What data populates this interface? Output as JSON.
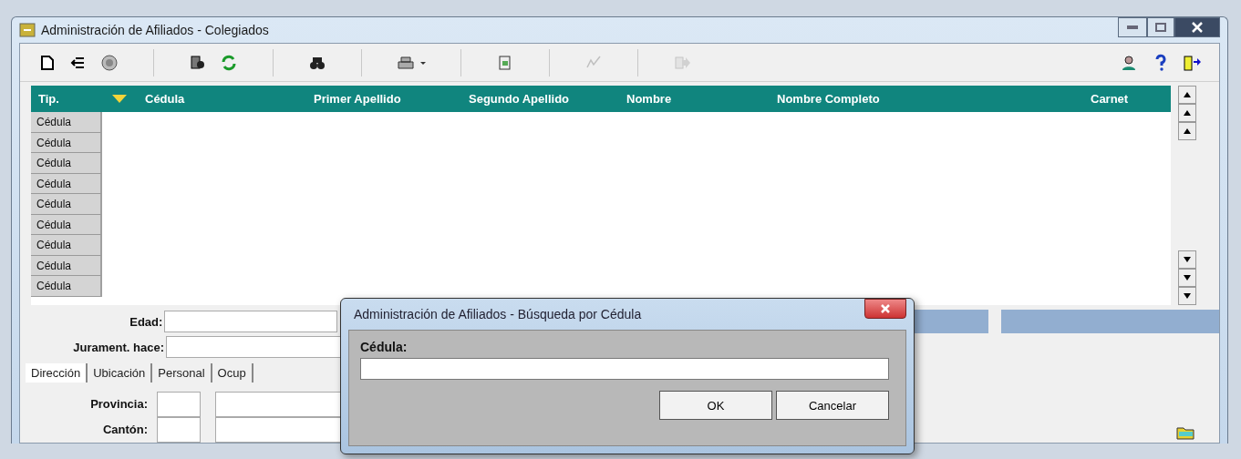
{
  "window": {
    "title": "Administración de Afiliados - Colegiados"
  },
  "toolbar": [
    {
      "kind": "new",
      "disabled": false
    },
    {
      "kind": "back",
      "disabled": false
    },
    {
      "kind": "seal",
      "disabled": false
    },
    {
      "kind": "sep"
    },
    {
      "kind": "find-doc",
      "disabled": false
    },
    {
      "kind": "refresh",
      "disabled": false
    },
    {
      "kind": "sep"
    },
    {
      "kind": "binoculars",
      "disabled": false
    },
    {
      "kind": "sep"
    },
    {
      "kind": "print",
      "disabled": false
    },
    {
      "kind": "sep"
    },
    {
      "kind": "export",
      "disabled": false
    },
    {
      "kind": "sep"
    },
    {
      "kind": "edit",
      "disabled": true
    },
    {
      "kind": "sep"
    },
    {
      "kind": "forward",
      "disabled": true
    },
    {
      "kind": "spacer"
    },
    {
      "kind": "user",
      "disabled": false
    },
    {
      "kind": "help",
      "disabled": false
    },
    {
      "kind": "exit",
      "disabled": false
    }
  ],
  "grid": {
    "columns": [
      {
        "label": "Tip.",
        "sorted": false
      },
      {
        "label": "Cédula",
        "sorted": true
      },
      {
        "label": "Primer Apellido",
        "sorted": false
      },
      {
        "label": "Segundo Apellido",
        "sorted": false
      },
      {
        "label": "Nombre",
        "sorted": false
      },
      {
        "label": "Nombre Completo",
        "sorted": false
      },
      {
        "label": "Carnet",
        "sorted": false
      }
    ],
    "rows": [
      "Cédula",
      "Cédula",
      "Cédula",
      "Cédula",
      "Cédula",
      "Cédula",
      "Cédula",
      "Cédula",
      "Cédula"
    ]
  },
  "form": {
    "age_label": "Edad:",
    "oath_label": "Jurament. hace:"
  },
  "tabs": [
    {
      "label": "Dirección",
      "selected": true
    },
    {
      "label": "Ubicación",
      "selected": false
    },
    {
      "label": "Personal",
      "selected": false
    },
    {
      "label": "Ocup",
      "selected": false
    }
  ],
  "address": [
    {
      "label": "Provincia:"
    },
    {
      "label": "Cantón:"
    }
  ],
  "dialog": {
    "title": "Administración de Afiliados - Búsqueda por Cédula",
    "field_label": "Cédula:",
    "buttons": [
      "OK",
      "Cancelar"
    ]
  }
}
